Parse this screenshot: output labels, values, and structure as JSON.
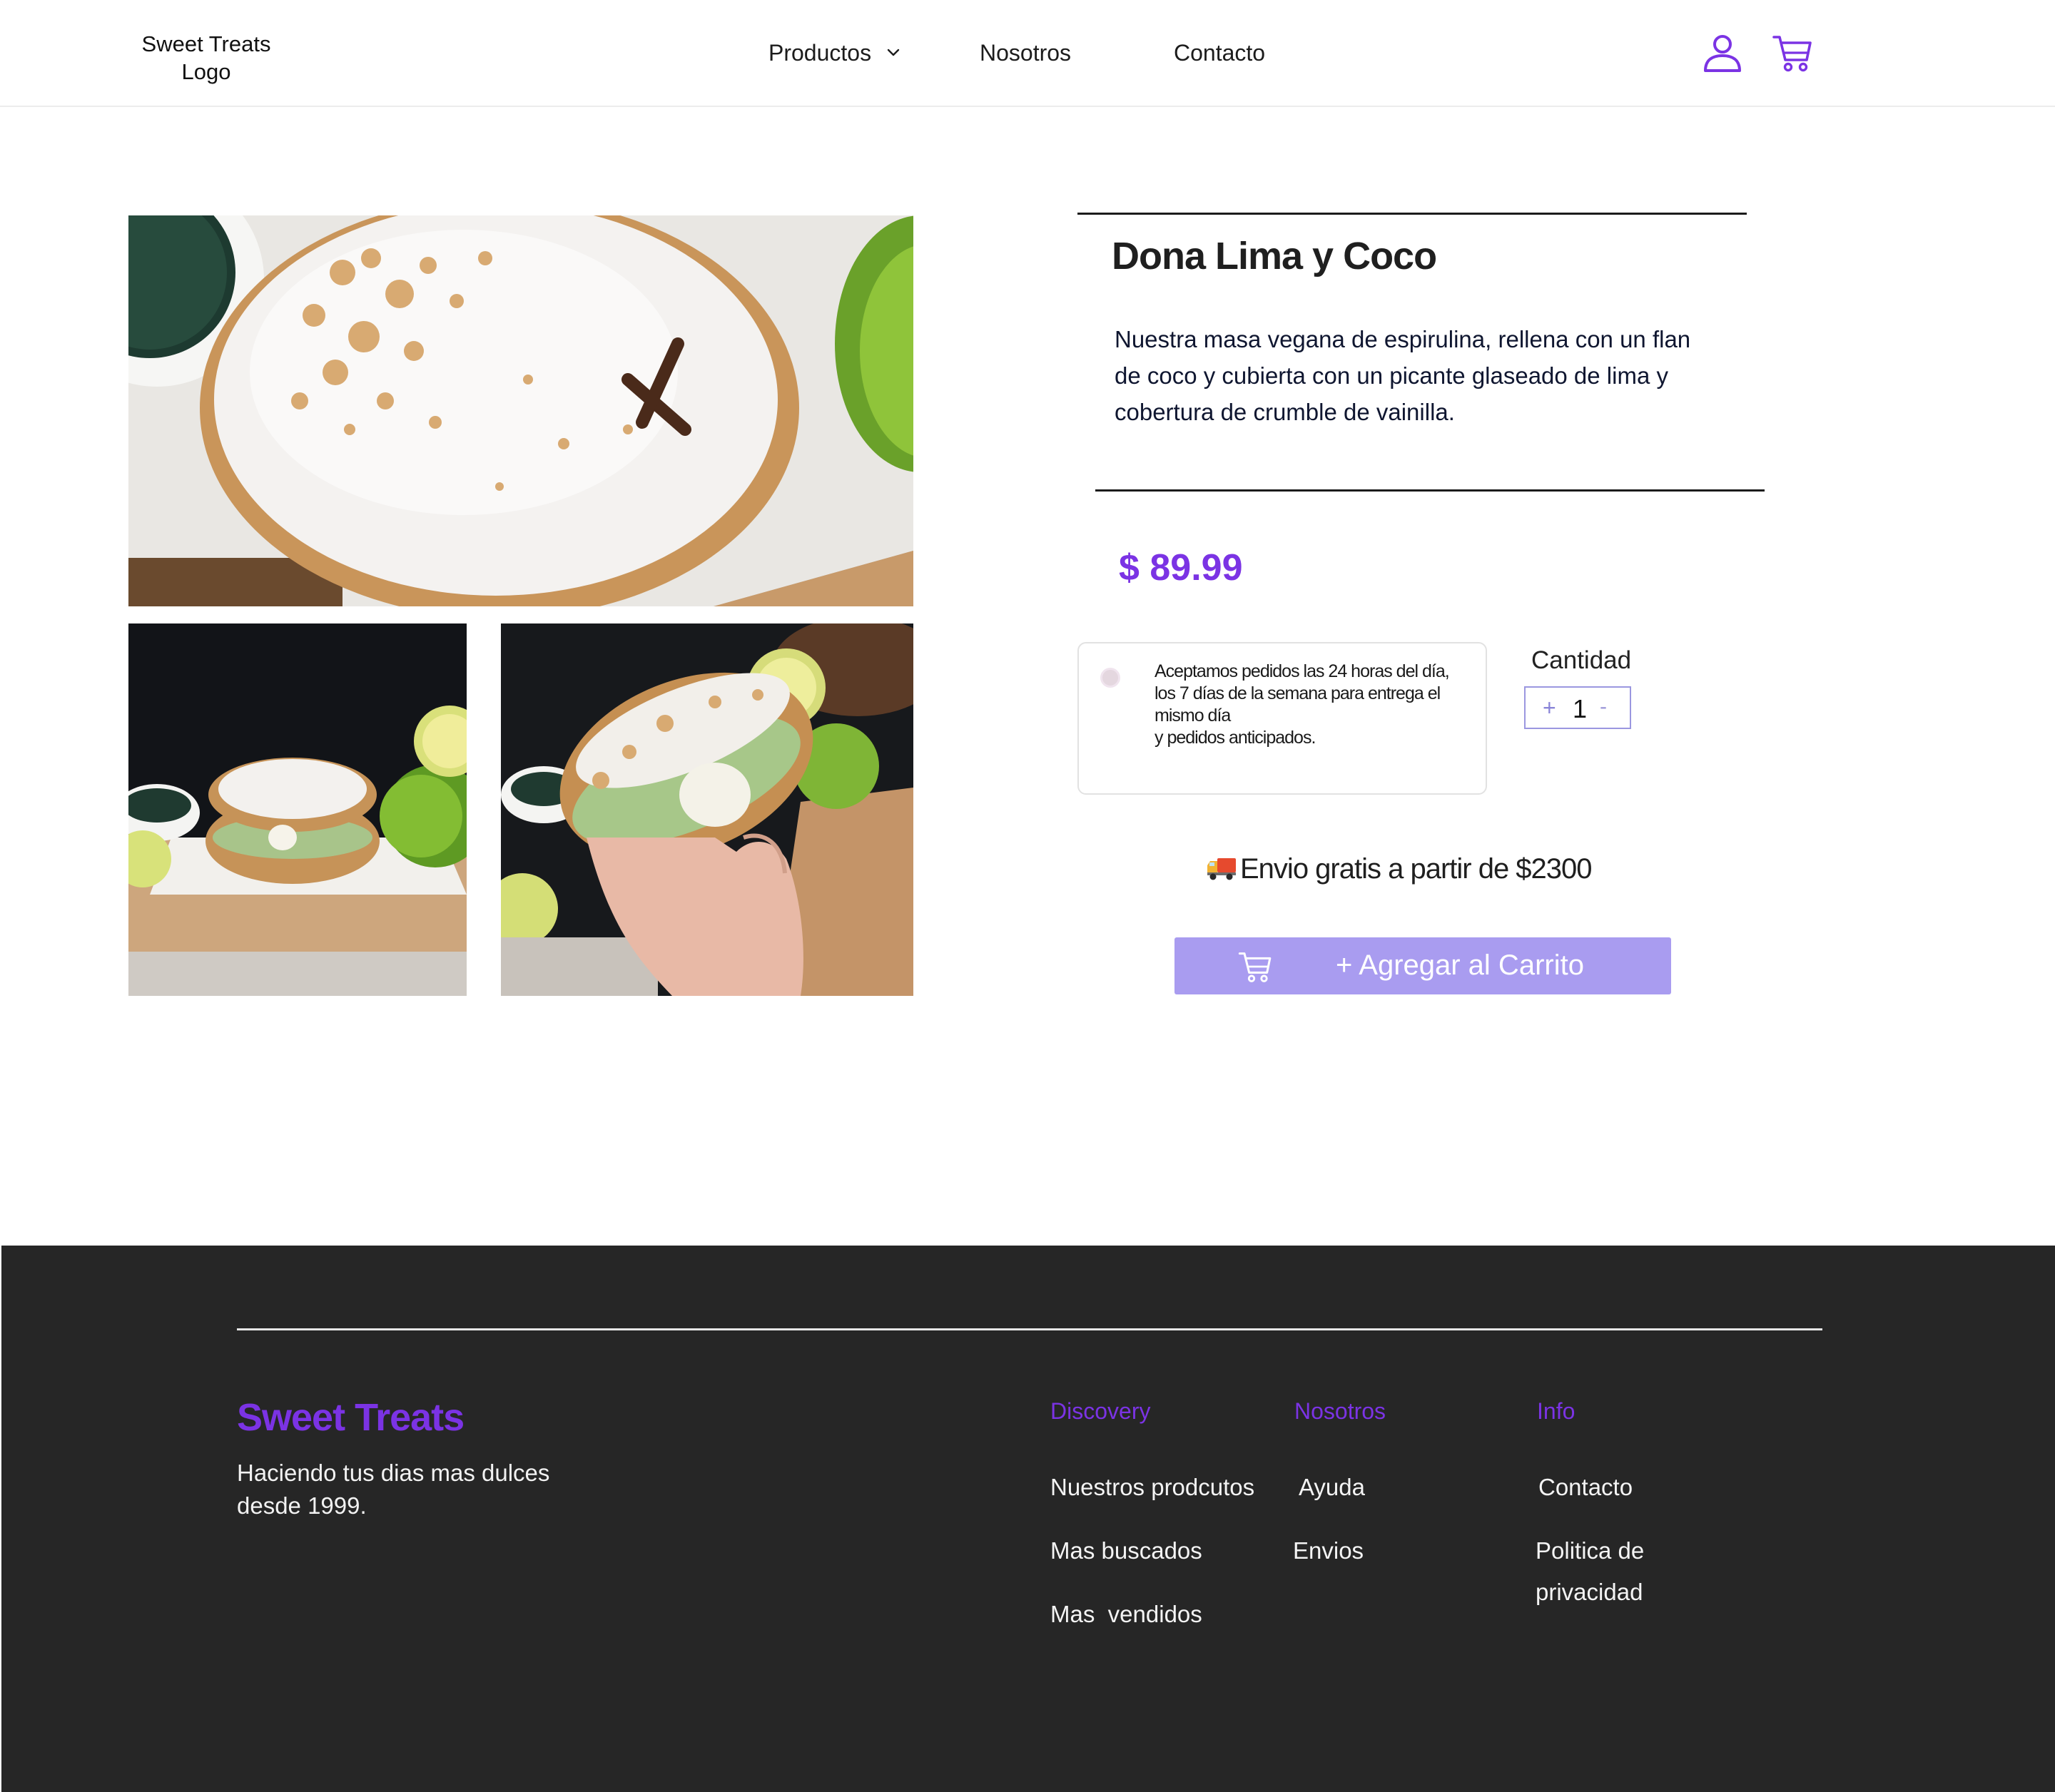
{
  "header": {
    "logo_text": "Sweet Treats Logo",
    "nav": [
      {
        "label": "Productos",
        "has_dropdown": true
      },
      {
        "label": "Nosotros"
      },
      {
        "label": "Contacto"
      }
    ],
    "icons": [
      "user-icon",
      "cart-icon"
    ],
    "icon_color": "#7b33e4"
  },
  "gallery": {
    "images": [
      "glazed-donut-top-view",
      "donut-on-board-with-limes",
      "bitten-donut-in-hand"
    ]
  },
  "product": {
    "title": "Dona Lima y Coco",
    "description": "Nuestra masa vegana de espirulina, rellena con un flan de coco y cubierta con un picante glaseado de lima y cobertura de crumble de vainilla.",
    "price": "$ 89.99",
    "notice": "Aceptamos pedidos las 24 horas del día,\nlos 7 días de la semana para entrega el mismo día\ny pedidos anticipados.",
    "quantity_label": "Cantidad",
    "quantity_plus": "+",
    "quantity_value": "1",
    "quantity_minus": "-",
    "shipping_text": "Envio gratis a partir de $2300",
    "add_to_cart": "+ Agregar al Carrito",
    "accent_color": "#7b33e4",
    "button_color": "#a99cf0"
  },
  "footer": {
    "brand": "Sweet Treats",
    "tagline": "Haciendo tus dias mas dulces desde 1999.",
    "columns": [
      {
        "heading": "Discovery",
        "links": [
          "Nuestros prodcutos",
          "Mas buscados",
          "Mas  vendidos"
        ]
      },
      {
        "heading": "Nosotros",
        "links": [
          "Ayuda",
          "Envios"
        ]
      },
      {
        "heading": "Info",
        "links": [
          "Contacto",
          "Politica de privacidad"
        ]
      }
    ],
    "background": "#262626"
  }
}
